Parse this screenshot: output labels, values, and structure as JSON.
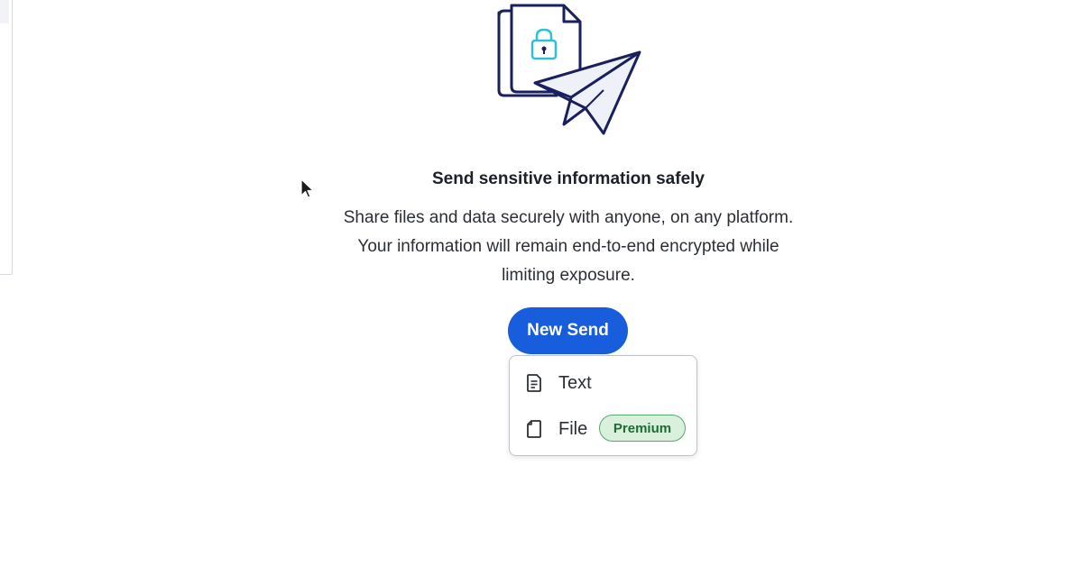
{
  "empty_state": {
    "title": "Send sensitive information safely",
    "description": "Share files and data securely with anyone, on any platform. Your information will remain end-to-end encrypted while limiting exposure.",
    "illustration": "send-lock-illustration"
  },
  "actions": {
    "new_send_label": "New Send"
  },
  "menu": {
    "items": [
      {
        "label": "Text",
        "icon": "text-document-icon"
      },
      {
        "label": "File",
        "icon": "file-icon",
        "badge": "Premium"
      }
    ]
  },
  "colors": {
    "primary": "#175ddc",
    "illustration_navy": "#1a1f5e",
    "illustration_teal": "#2ec1d6",
    "badge_bg": "#d8f0dc",
    "badge_text": "#1f6b33"
  }
}
